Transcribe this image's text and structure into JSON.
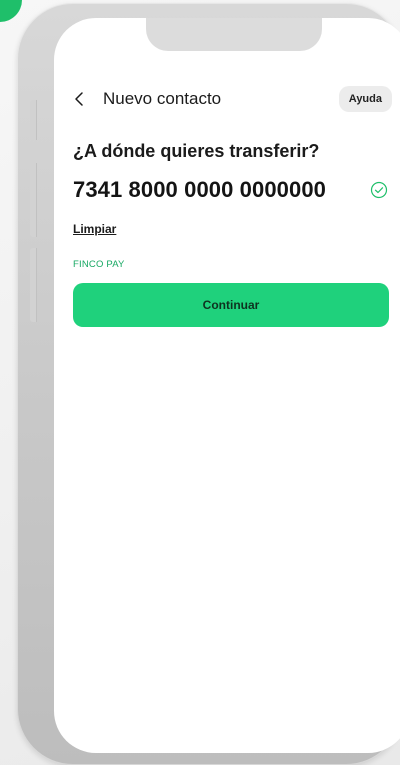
{
  "header": {
    "title": "Nuevo contacto",
    "help_label": "Ayuda"
  },
  "form": {
    "question": "¿A dónde quieres transferir?",
    "account_number": "7341 8000 0000 0000000",
    "clear_label": "Limpiar",
    "bank_name": "FINCO PAY",
    "continue_label": "Continuar"
  },
  "icons": {
    "back": "chevron-left-icon",
    "valid": "check-circle-icon"
  },
  "colors": {
    "primary": "#1fd17c",
    "bank_label": "#17a863",
    "check": "#1fbf6a",
    "brand_blob": "#1fbf6a"
  }
}
